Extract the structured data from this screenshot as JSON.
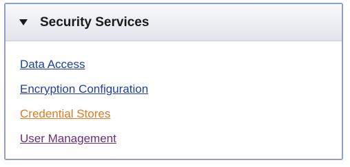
{
  "panel": {
    "title": "Security Services",
    "toggle_icon": "triangle-down-icon",
    "links": [
      {
        "label": "Data Access",
        "state": "unvisited",
        "color": "#1e40a0"
      },
      {
        "label": "Encryption Configuration",
        "state": "unvisited",
        "color": "#1e40a0"
      },
      {
        "label": "Credential Stores",
        "state": "hover",
        "color": "#e07a1f"
      },
      {
        "label": "User Management",
        "state": "visited",
        "color": "#6b2f7a"
      }
    ]
  },
  "colors": {
    "border": "#8c9fc8",
    "header_bg": "#eceef3"
  }
}
